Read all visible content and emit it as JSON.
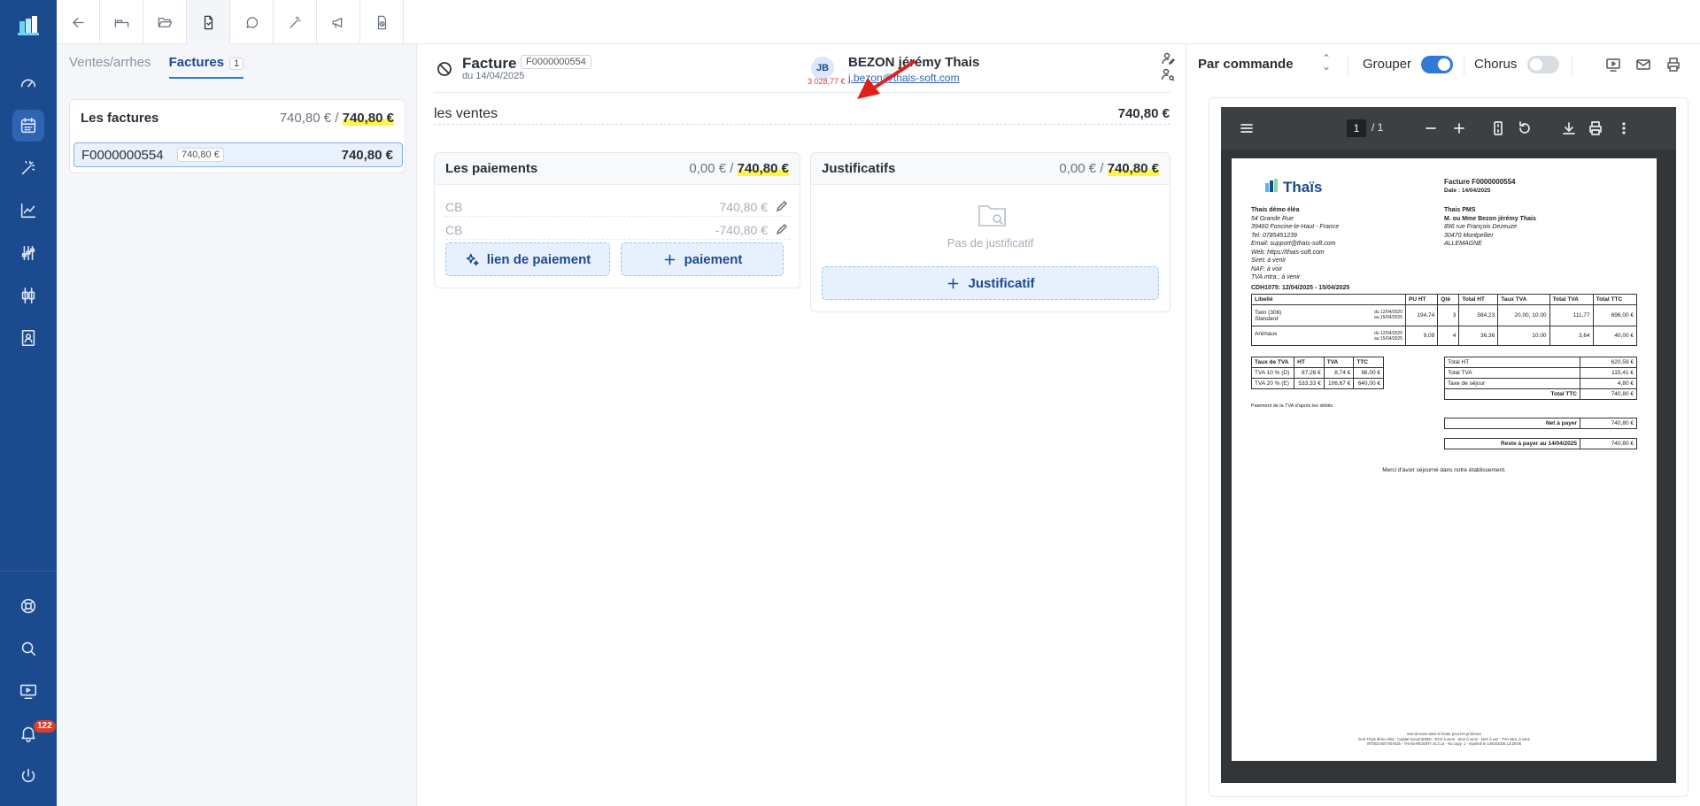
{
  "nav": {
    "badge_count": "122"
  },
  "left": {
    "tabs": [
      {
        "label": "Ventes/arrhes"
      },
      {
        "label": "Factures",
        "count": "1"
      }
    ],
    "card_title": "Les factures",
    "card_total_paid": "740,80 €",
    "card_total_sep": " / ",
    "card_total": "740,80 €",
    "invoice_number": "F0000000554",
    "invoice_chip": "740,80 €",
    "invoice_amount": "740,80 €"
  },
  "invoice": {
    "title": "Facture",
    "number": "F0000000554",
    "date": "du 14/04/2025",
    "avatar": "JB",
    "balance": "3 028,77 €",
    "customer_name": "BEZON jérémy Thais",
    "customer_email": "j.bezon@thais-soft.com",
    "sales_label": "les ventes",
    "sales_amount": "740,80 €"
  },
  "payments": {
    "title": "Les paiements",
    "paid": "0,00 €",
    "sep": " / ",
    "total": "740,80 €",
    "lines": [
      {
        "method": "CB",
        "amount": "740,80 €"
      },
      {
        "method": "CB",
        "amount": "-740,80 €"
      }
    ],
    "link_button": "lien de paiement",
    "add_button": "paiement"
  },
  "justif": {
    "title": "Justificatifs",
    "paid": "0,00 €",
    "sep": " / ",
    "total": "740,80 €",
    "empty": "Pas de justificatif",
    "add_button": "Justificatif"
  },
  "preview": {
    "group_select": "Par commande",
    "grouper_label": "Grouper",
    "chorus_label": "Chorus",
    "pdf_page": "1",
    "pdf_of": "/  1",
    "doc": {
      "brand": "Thaïs",
      "title": "Facture F0000000554",
      "date": "Date : 14/04/2025",
      "seller_name": "Thais démo élèa",
      "seller_lines": [
        "54 Grande Rue",
        "39460 Foncine-le-Haut - France",
        "Tel: 0785451239",
        "Email: support@thais-soft.com",
        "Web: https://thais-soft.com",
        "Siret: à venir",
        "NAF: à voir",
        "TVA intra.: à venir"
      ],
      "client_name": "Thais PMS",
      "client_lines": [
        "M. ou Mme Bezon jérémy Thais",
        "896 rue François Dezeuze",
        "30470 Montpellier",
        "ALLEMAGNE"
      ],
      "stay": "CDH1075: 12/04/2025 - 15/04/2025",
      "table_headers": [
        "Libellé",
        "PU HT",
        "Qté",
        "Total HT",
        "Taux TVA",
        "Total TVA",
        "Total TTC"
      ],
      "rows": [
        {
          "label": "Twin (306)",
          "sub": "Standard",
          "from": "du 12/04/2025",
          "to": "au 15/04/2025",
          "pu": "194,74",
          "qty": "3",
          "ht": "584,23",
          "rate": "20.00, 10.00",
          "tva": "111,77",
          "ttc": "696,00 €"
        },
        {
          "label": "Animaux",
          "sub": "",
          "from": "du 12/04/2025",
          "to": "au 15/04/2025",
          "pu": "9,09",
          "qty": "4",
          "ht": "36,36",
          "rate": "10.00",
          "tva": "3,64",
          "ttc": "40,00 €"
        }
      ],
      "vat_headers": [
        "Taux de TVA",
        "HT",
        "TVA",
        "TTC"
      ],
      "vat_rows": [
        [
          "TVA 10 % (D)",
          "87,26 €",
          "8,74 €",
          "96,00 €"
        ],
        [
          "TVA 20 % (E)",
          "533,33 €",
          "106,67 €",
          "640,00 €"
        ]
      ],
      "vat_note": "Paiement de la TVA d'après les débits",
      "totals": [
        [
          "Total HT",
          "620,59 €"
        ],
        [
          "Total TVA",
          "115,41 €"
        ],
        [
          "Taxe de séjour",
          "4,80 €"
        ],
        [
          "Total TTC",
          "740,80 €"
        ]
      ],
      "net_label": "Net à payer",
      "net_value": "740,80 €",
      "rest_label": "Reste à payer au 14/04/2025",
      "rest_value": "740,80 €",
      "thanks": "Merci d'avoir séjourné dans notre établissement.",
      "footer_1": "test de texte dans le footer pour les proforma",
      "footer_2": "SAS Thais démo élèa - Capital Social 50000 - RCS à venir - Siret à venir - NAF à voir - TVA intra. à venir",
      "footer_3": "INT003 B0778/A025 - THAIS-RESORT v4.3.14 - No copy: 1 - imprimé le 14/04/2025 13:29:06"
    }
  },
  "colors": {
    "rail": "#1c4a8f",
    "accent": "#2f7ad9",
    "highlight": "#fff34d",
    "arrow": "#e0201c"
  }
}
